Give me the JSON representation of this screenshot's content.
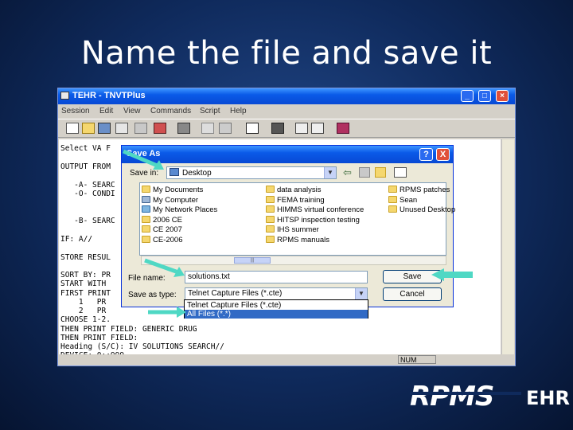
{
  "slide": {
    "title": "Name the file and save it",
    "logo_main": "RPMS",
    "logo_sub": "EHR"
  },
  "terminal": {
    "window_title": "TEHR - TNVTPlus",
    "menu": [
      "Session",
      "Edit",
      "View",
      "Commands",
      "Script",
      "Help"
    ],
    "status_num": "NUM",
    "lines": [
      "Select VA F",
      "",
      "OUTPUT FROM",
      "",
      "   -A- SEARC",
      "   -O- CONDI",
      "",
      "",
      "   -B- SEARC",
      "",
      "IF: A//",
      "",
      "STORE RESUL",
      "",
      "SORT BY: PR",
      "START WITH",
      "FIRST PRINT",
      "    1   PR",
      "    2   PR",
      "CHOOSE 1-2.",
      "THEN PRINT FIELD: GENERIC DRUG",
      "THEN PRINT FIELD:",
      "Heading (S/C): IV SOLUTIONS SEARCH//",
      "DEVICE: 0;;999"
    ]
  },
  "dialog": {
    "title": "Save As",
    "help_label": "?",
    "close_label": "X",
    "save_in_label": "Save in:",
    "save_in_value": "Desktop",
    "files": [
      {
        "name": "My Documents",
        "icon": "my-documents-icon"
      },
      {
        "name": "My Computer",
        "icon": "my-computer-icon"
      },
      {
        "name": "My Network Places",
        "icon": "network-places-icon"
      },
      {
        "name": "2006 CE",
        "icon": "folder-icon"
      },
      {
        "name": "CE 2007",
        "icon": "folder-icon"
      },
      {
        "name": "CE-2006",
        "icon": "folder-icon"
      },
      {
        "name": "data analysis",
        "icon": "folder-icon"
      },
      {
        "name": "FEMA training",
        "icon": "folder-icon"
      },
      {
        "name": "HIMMS virtual conference",
        "icon": "folder-icon"
      },
      {
        "name": "HITSP inspection testing",
        "icon": "folder-icon"
      },
      {
        "name": "IHS summer",
        "icon": "folder-icon"
      },
      {
        "name": "RPMS manuals",
        "icon": "folder-icon"
      },
      {
        "name": "RPMS patches",
        "icon": "folder-icon"
      },
      {
        "name": "Sean",
        "icon": "folder-icon"
      },
      {
        "name": "Unused Desktop",
        "icon": "folder-icon"
      }
    ],
    "file_name_label": "File name:",
    "file_name_value": "solutions.txt",
    "save_type_label": "Save as type:",
    "save_type_value": "Telnet Capture Files (*.cte)",
    "type_options": [
      "Telnet Capture Files (*.cte)",
      "All Files (*.*)"
    ],
    "save_button": "Save",
    "cancel_button": "Cancel"
  },
  "colors": {
    "slide_bg": "#0f2a5c",
    "title_bar": "#0a5ae8",
    "arrow": "#4fd8c4",
    "selection": "#316ac5"
  }
}
